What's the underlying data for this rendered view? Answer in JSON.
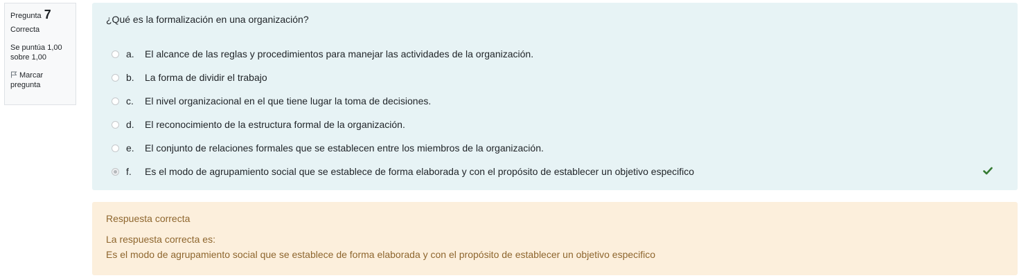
{
  "info": {
    "question_label": "Pregunta",
    "question_number": "7",
    "state": "Correcta",
    "grade": "Se puntúa 1,00 sobre 1,00",
    "flag_label": "Marcar pregunta"
  },
  "question": {
    "text": "¿Qué es la formalización en una organización?",
    "options": [
      {
        "letter": "a.",
        "text": "El alcance de las reglas y procedimientos para manejar las actividades de la organización.",
        "selected": false
      },
      {
        "letter": "b.",
        "text": "La forma de dividir el trabajo",
        "selected": false
      },
      {
        "letter": "c.",
        "text": "El nivel organizacional en el que tiene lugar la toma de decisiones.",
        "selected": false
      },
      {
        "letter": "d.",
        "text": "El reconocimiento de la estructura formal de la organización.",
        "selected": false
      },
      {
        "letter": "e.",
        "text": "El conjunto de relaciones formales que se establecen entre los miembros de la organización.",
        "selected": false
      },
      {
        "letter": "f.",
        "text": "Es el modo de agrupamiento social que se establece de forma elaborada y con el propósito de establecer un objetivo especifico",
        "selected": true,
        "correct": true
      }
    ]
  },
  "feedback": {
    "result": "Respuesta correcta",
    "right_answer_label": "La respuesta correcta es:",
    "right_answer": "Es el modo de agrupamiento social que se establece de forma elaborada y con el propósito de establecer un objetivo especifico"
  },
  "colors": {
    "formulation_bg": "#e7f3f5",
    "feedback_bg": "#fcefdc",
    "feedback_text": "#8e662e",
    "correct_check": "#357a32"
  },
  "icons": {
    "flag": "flag-icon",
    "correct": "check-icon"
  }
}
